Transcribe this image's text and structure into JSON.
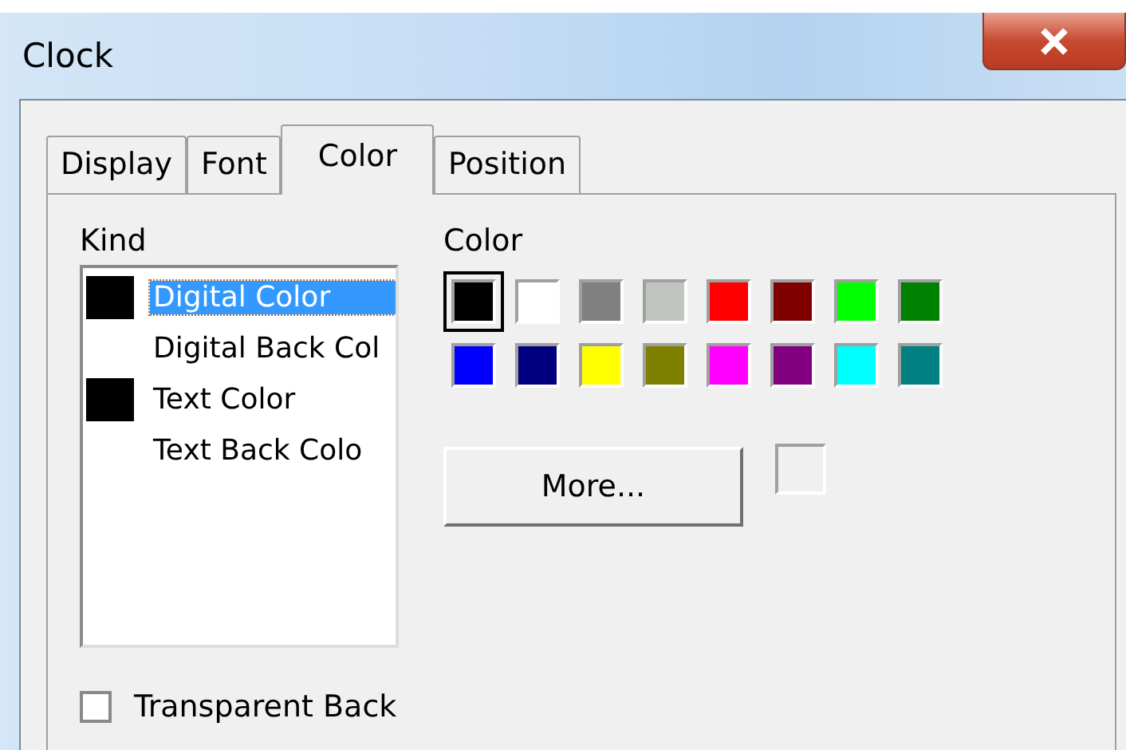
{
  "window": {
    "title": "Clock"
  },
  "tabs": [
    {
      "label": "Display",
      "selected": false
    },
    {
      "label": "Font",
      "selected": false
    },
    {
      "label": "Color",
      "selected": true
    },
    {
      "label": "Position",
      "selected": false
    }
  ],
  "kind": {
    "label": "Kind",
    "items": [
      {
        "label": "Digital Color",
        "color": "#000000",
        "selected": true
      },
      {
        "label": "Digital Back Col",
        "selected": false
      },
      {
        "label": "Text Color",
        "color": "#000000",
        "selected": false
      },
      {
        "label": "Text Back Colo",
        "selected": false
      }
    ]
  },
  "palette": {
    "label": "Color",
    "swatches": [
      {
        "color": "#000000",
        "selected": true
      },
      {
        "color": "#ffffff",
        "selected": false
      },
      {
        "color": "#808080",
        "selected": false
      },
      {
        "color": "#c0c4bf",
        "selected": false
      },
      {
        "color": "#ff0000",
        "selected": false
      },
      {
        "color": "#800000",
        "selected": false
      },
      {
        "color": "#00ff00",
        "selected": false
      },
      {
        "color": "#008000",
        "selected": false
      },
      {
        "color": "#0000ff",
        "selected": false
      },
      {
        "color": "#000080",
        "selected": false
      },
      {
        "color": "#ffff00",
        "selected": false
      },
      {
        "color": "#808000",
        "selected": false
      },
      {
        "color": "#ff00ff",
        "selected": false
      },
      {
        "color": "#800080",
        "selected": false
      },
      {
        "color": "#00ffff",
        "selected": false
      },
      {
        "color": "#008080",
        "selected": false
      }
    ]
  },
  "more_button": "More...",
  "transparent_back": {
    "label": "Transparent Back",
    "checked": false
  }
}
